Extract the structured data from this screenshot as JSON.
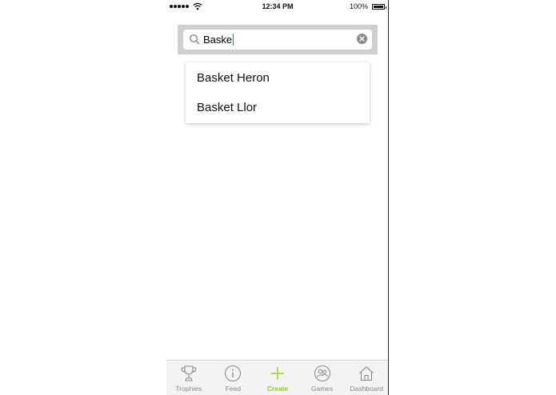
{
  "status_bar": {
    "time": "12:34 PM",
    "battery": "100%"
  },
  "search": {
    "value": "Baske",
    "icon": "search-icon",
    "clear_icon": "clear-icon"
  },
  "suggestions": [
    {
      "label": "Basket Heron"
    },
    {
      "label": "Basket Llor"
    }
  ],
  "tab_bar": {
    "tabs": [
      {
        "label": "Trophies",
        "icon": "trophy-icon"
      },
      {
        "label": "Feed",
        "icon": "info-icon"
      },
      {
        "label": "Create",
        "icon": "plus-icon",
        "active": true
      },
      {
        "label": "Games",
        "icon": "games-icon"
      },
      {
        "label": "Dashboard",
        "icon": "home-icon"
      }
    ]
  },
  "colors": {
    "accent": "#8cd21a",
    "search_bar_bg": "#cfcfcf",
    "tab_bar_bg": "#f3f3f3",
    "inactive": "#8a8a8a"
  }
}
